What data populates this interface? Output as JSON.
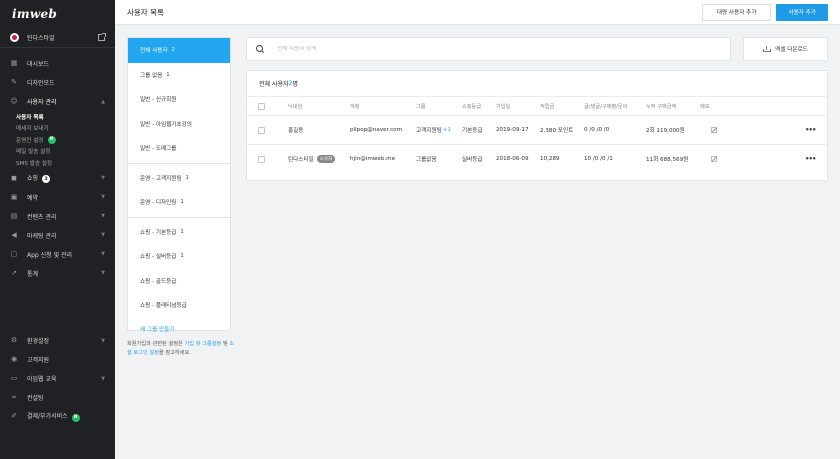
{
  "logo": "imweb",
  "site": {
    "name": "틴다스타일"
  },
  "sidebar": {
    "items": [
      {
        "label": "대시보드",
        "icon": "grid-icon"
      },
      {
        "label": "디자인모드",
        "icon": "wand-icon"
      },
      {
        "label": "사용자 관리",
        "icon": "user-icon"
      },
      {
        "label": "쇼핑",
        "icon": "bag-icon",
        "badge": "3"
      },
      {
        "label": "예약",
        "icon": "calendar-icon"
      },
      {
        "label": "컨텐츠 관리",
        "icon": "content-icon"
      },
      {
        "label": "마케팅 관리",
        "icon": "megaphone-icon"
      },
      {
        "label": "App 신청 및 관리",
        "icon": "app-icon"
      },
      {
        "label": "통계",
        "icon": "chart-icon"
      }
    ],
    "user_submenu": [
      "사용자 목록",
      "메세지 보내기",
      "운영진 설정",
      "메일 발송 설정",
      "SMS 발송 설정"
    ],
    "operator_badge": "N",
    "bottom": [
      {
        "label": "환경설정",
        "icon": "gear-icon"
      },
      {
        "label": "고객지원",
        "icon": "support-icon"
      },
      {
        "label": "아임웹 교육",
        "icon": "education-icon"
      },
      {
        "label": "컨설팅",
        "icon": "consulting-icon"
      },
      {
        "label": "결제/부가서비스",
        "icon": "payment-icon",
        "badge": "N"
      }
    ]
  },
  "header": {
    "title": "사용자 목록",
    "bulk_add_label": "대량 사용자 추가",
    "add_label": "사용자 추가"
  },
  "groups": {
    "items": [
      {
        "label": "전체 사용자",
        "count": "2"
      },
      {
        "label": "그룹 없음",
        "count": "1"
      },
      {
        "label": "일반 - 신규회원",
        "count": ""
      },
      {
        "label": "일반 - 아임웹기초강의",
        "count": ""
      },
      {
        "label": "일반 - 도메그룹",
        "count": ""
      },
      {
        "label": "운영 - 고객지원팀",
        "count": "1"
      },
      {
        "label": "운영 - 디자인팀",
        "count": "1"
      },
      {
        "label": "쇼핑 - 기본등급",
        "count": "1"
      },
      {
        "label": "쇼핑 - 실버등급",
        "count": "1"
      },
      {
        "label": "쇼핑 - 골드등급",
        "count": ""
      },
      {
        "label": "쇼핑 - 플래티넘등급",
        "count": ""
      }
    ],
    "new_group_label": "새 그룹 만들기",
    "help_prefix": "회원가입과 관련된 설정은 ",
    "help_link1": "가입 및 그룹설정",
    "help_mid": " 및 ",
    "help_link2": "소셜 로그인 설정",
    "help_suffix": "을 참고하세요."
  },
  "search": {
    "placeholder": "전체 사용자 검색",
    "value": ""
  },
  "excel_label": "엑셀 다운로드",
  "users": {
    "summary_prefix": "전체 사용자 ",
    "summary_count": "2",
    "summary_suffix": "명",
    "columns": [
      "닉네임",
      "계정",
      "그룹",
      "쇼핑등급",
      "가입일",
      "적립금",
      "글/댓글/구매평/문의",
      "누적 구매금액",
      "메모"
    ],
    "rows": [
      {
        "nickname": "홍길동",
        "owner_tag": "",
        "account": "pilpop@naver.com",
        "group": "고객지원팀",
        "group_extra": "+1",
        "grade": "기본등급",
        "joined": "2019-09-17",
        "points": "2,380 포인트",
        "activity": "0 /0 /0 /0",
        "purchases": "2회 119,000원"
      },
      {
        "nickname": "틴다스타일",
        "owner_tag": "소유자",
        "account": "hjin@imweb.me",
        "group": "그룹없음",
        "group_extra": "",
        "grade": "실버등급",
        "joined": "2018-06-09",
        "points": "10,289",
        "activity": "10 /0 /0 /1",
        "purchases": "11회 688,569원"
      }
    ]
  },
  "colors": {
    "accent": "#21a6ef",
    "primary_button": "#1f9ae6",
    "sidebar_bg": "#202124",
    "new_badge": "#21c362"
  }
}
